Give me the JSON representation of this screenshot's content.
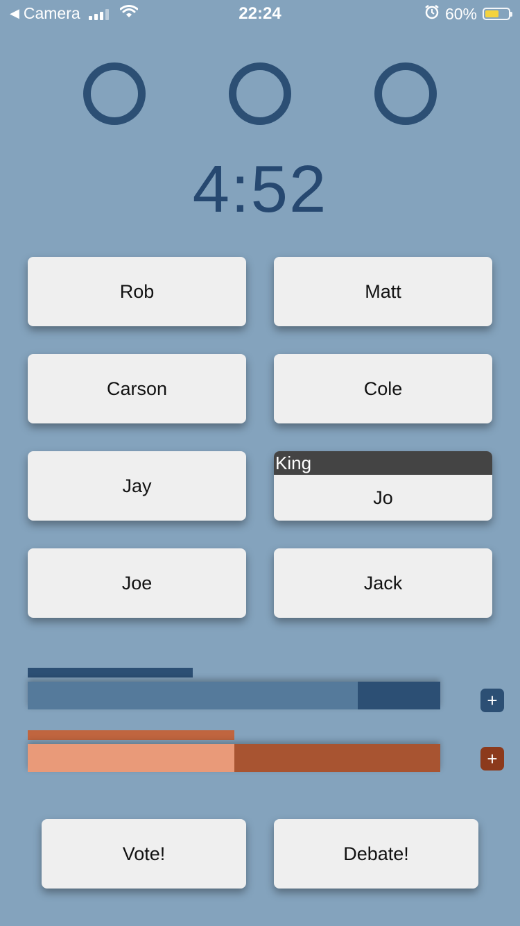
{
  "status_bar": {
    "back_label": "Camera",
    "time": "22:24",
    "battery_text": "60%",
    "battery_level": 0.6
  },
  "circles": [
    "circle-1",
    "circle-2",
    "circle-3"
  ],
  "timer": "4:52",
  "players": [
    {
      "name": "Rob"
    },
    {
      "name": "Matt"
    },
    {
      "name": "Carson"
    },
    {
      "name": "Cole"
    },
    {
      "name": "Jay"
    },
    {
      "name": "Jo",
      "badge": "King"
    },
    {
      "name": "Joe"
    },
    {
      "name": "Jack"
    }
  ],
  "vote_bars": {
    "blue": {
      "top_level": 0.4,
      "main_level": 0.8,
      "colors": {
        "light": "#557a9b",
        "dark": "#2c4f74"
      }
    },
    "orange": {
      "top_level": 0.5,
      "main_level": 0.5,
      "colors": {
        "light": "#e99a79",
        "dark": "#a85431"
      }
    },
    "plus_label": "+"
  },
  "actions": {
    "vote_label": "Vote!",
    "debate_label": "Debate!"
  }
}
